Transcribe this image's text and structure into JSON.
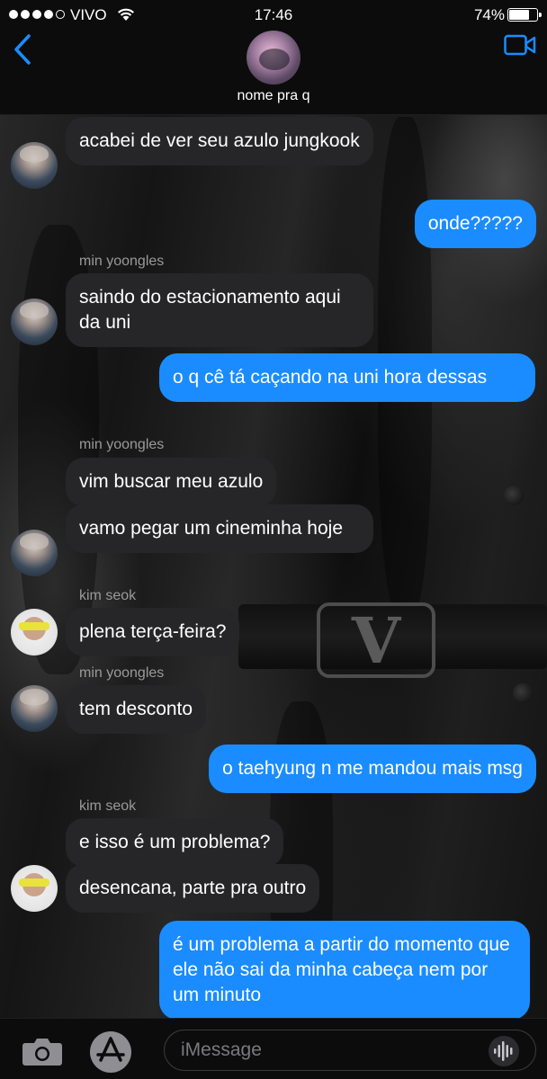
{
  "status_bar": {
    "carrier": "VIVO",
    "time": "17:46",
    "battery_percent": "74%",
    "battery_level": 0.74,
    "signal_bars_filled": 4,
    "signal_bars_total": 5
  },
  "header": {
    "back_icon": "chevron-left-icon",
    "group_name": "nome pra q",
    "video_icon": "video-camera-icon",
    "accent_color": "#1a8cff"
  },
  "messages": [
    {
      "direction": "in",
      "text": "acabei de ver seu azulo jungkook"
    },
    {
      "direction": "out",
      "text": "onde?????"
    },
    {
      "direction": "in",
      "sender": "min yoongles",
      "text": "saindo do estacionamento aqui da uni"
    },
    {
      "direction": "out",
      "text": "o q cê tá caçando na uni hora dessas"
    },
    {
      "direction": "in",
      "sender": "min yoongles",
      "text": "vim buscar meu azulo"
    },
    {
      "direction": "in",
      "text": "vamo pegar um cineminha hoje"
    },
    {
      "direction": "in",
      "sender": "kim seok",
      "text": "plena terça-feira?"
    },
    {
      "direction": "in",
      "sender": "min yoongles",
      "text": "tem desconto"
    },
    {
      "direction": "out",
      "text": "o taehyung n me mandou mais msg"
    },
    {
      "direction": "in",
      "sender": "kim seok",
      "text": "e isso é um problema?"
    },
    {
      "direction": "in",
      "text": "desencana, parte pra outro"
    },
    {
      "direction": "out",
      "text": "é um problema a partir do momento que ele não sai da minha cabeça nem por um minuto"
    }
  ],
  "input_bar": {
    "camera_icon": "camera-icon",
    "apps_icon": "app-store-icon",
    "placeholder": "iMessage",
    "audio_icon": "audio-waveform-icon"
  },
  "colors": {
    "incoming_bubble": "#262628",
    "outgoing_bubble": "#1a8cff",
    "bar_background": "#0c0c0c"
  }
}
